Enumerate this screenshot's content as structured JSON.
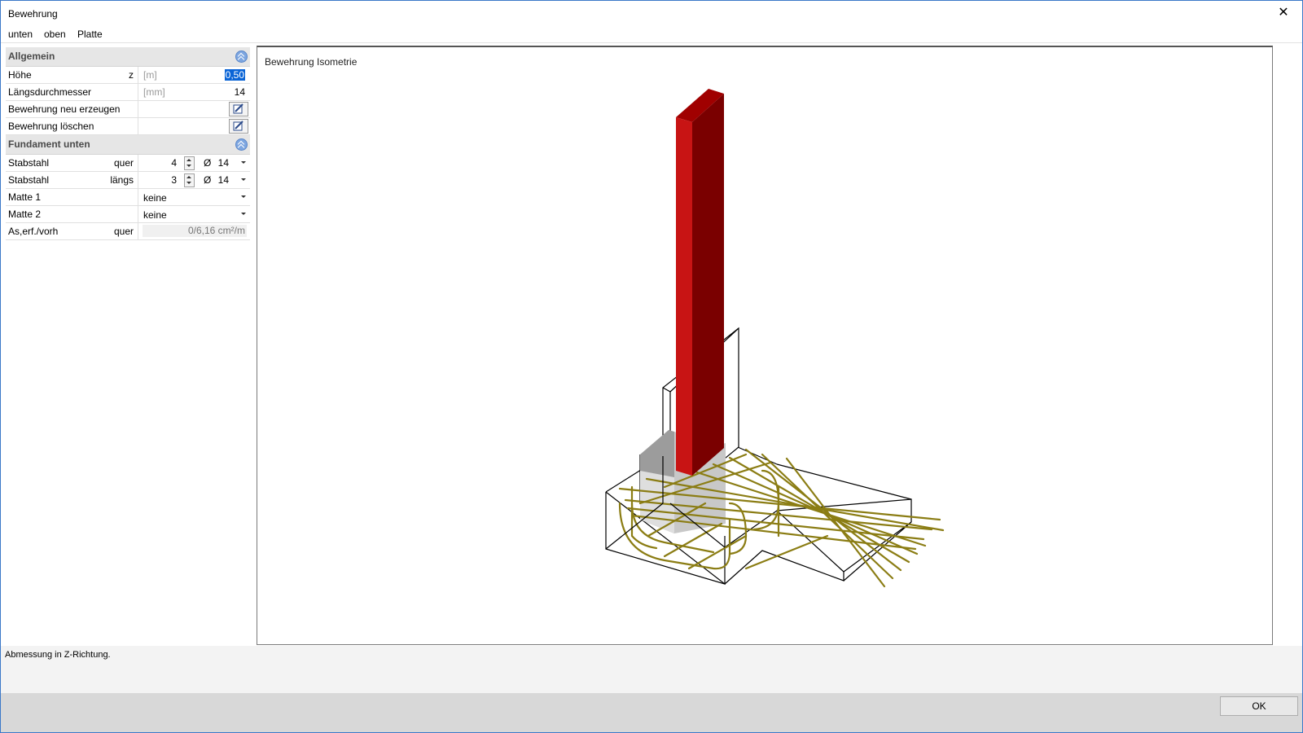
{
  "window": {
    "title": "Bewehrung",
    "close_glyph": "✕"
  },
  "menu": [
    "unten",
    "oben",
    "Platte"
  ],
  "sections": {
    "allgemein": {
      "title": "Allgemein",
      "rows": {
        "hoehe": {
          "label": "Höhe",
          "sub": "z",
          "unit": "[m]",
          "value": "0,50"
        },
        "laengsdurchmesser": {
          "label": "Längsdurchmesser",
          "unit": "[mm]",
          "value": "14"
        },
        "neu": {
          "label": "Bewehrung neu erzeugen"
        },
        "loeschen": {
          "label": "Bewehrung löschen"
        }
      }
    },
    "fundament_unten": {
      "title": "Fundament unten",
      "rows": {
        "stab_quer": {
          "label": "Stabstahl",
          "sub": "quer",
          "count": "4",
          "dia_symbol": "Ø",
          "dia": "14"
        },
        "stab_laengs": {
          "label": "Stabstahl",
          "sub": "längs",
          "count": "3",
          "dia_symbol": "Ø",
          "dia": "14"
        },
        "matte1": {
          "label": "Matte 1",
          "value": "keine"
        },
        "matte2": {
          "label": "Matte 2",
          "value": "keine"
        },
        "as": {
          "label": "As,erf./vorh",
          "sub": "quer",
          "value": "0/6,16 cm²/m"
        }
      }
    }
  },
  "viewport": {
    "title": "Bewehrung Isometrie"
  },
  "colors": {
    "column": "#c00000",
    "column_side": "#7a0000",
    "rebar": "#8b7d14",
    "selection": "#0a64d6"
  },
  "status": {
    "text": "Abmessung in Z-Richtung."
  },
  "buttons": {
    "ok": "OK"
  }
}
